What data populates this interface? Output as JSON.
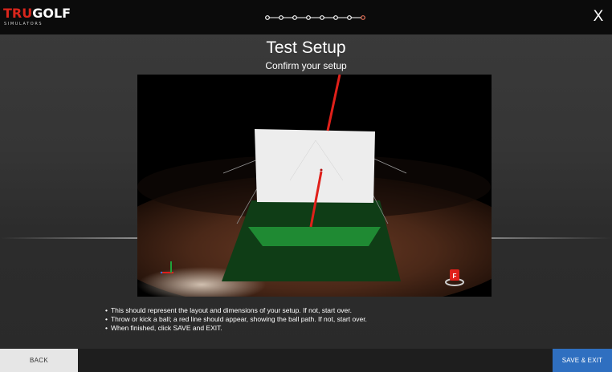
{
  "header": {
    "logo_text_red": "TRU",
    "logo_text_white": "GOLF",
    "logo_subtext": "SIMULATORS",
    "close_label": "X",
    "steps_total": 8,
    "steps_current": 8
  },
  "main": {
    "title": "Test Setup",
    "subtitle": "Confirm your setup",
    "scene_marker_label": "F",
    "instructions": [
      "This should represent the layout and dimensions of your setup. If not, start over.",
      "Throw or kick a ball; a red line should appear, showing the ball path. If not, start over.",
      "When finished, click SAVE and EXIT."
    ]
  },
  "footer": {
    "back_label": "BACK",
    "save_label": "SAVE & EXIT"
  },
  "colors": {
    "brand_red": "#d9261c",
    "save_blue": "#2f6fc0",
    "active_step": "#e8735a"
  }
}
